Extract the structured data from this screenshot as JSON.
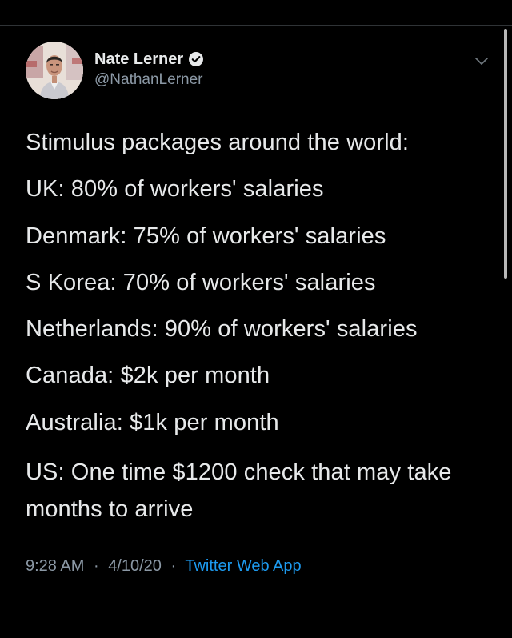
{
  "tweet": {
    "author": {
      "display_name": "Nate Lerner",
      "handle": "@NathanLerner",
      "verified": true
    },
    "text_lines": [
      "Stimulus packages around the world:",
      "UK: 80% of workers' salaries",
      "Denmark: 75% of workers' salaries",
      "S Korea: 70% of workers' salaries",
      "Netherlands: 90% of workers' salaries",
      "Canada: $2k per month",
      "Australia: $1k per month",
      "US: One time $1200 check that may take months to arrive"
    ],
    "meta": {
      "time": "9:28 AM",
      "separator": "·",
      "date": "4/10/20",
      "source": "Twitter Web App"
    }
  },
  "colors": {
    "background": "#000000",
    "primary_text": "#e7e9ea",
    "secondary_text": "#8b98a5",
    "link": "#1d9bf0"
  },
  "icons": {
    "verified": "verified-badge-icon",
    "menu": "chevron-down-icon"
  }
}
